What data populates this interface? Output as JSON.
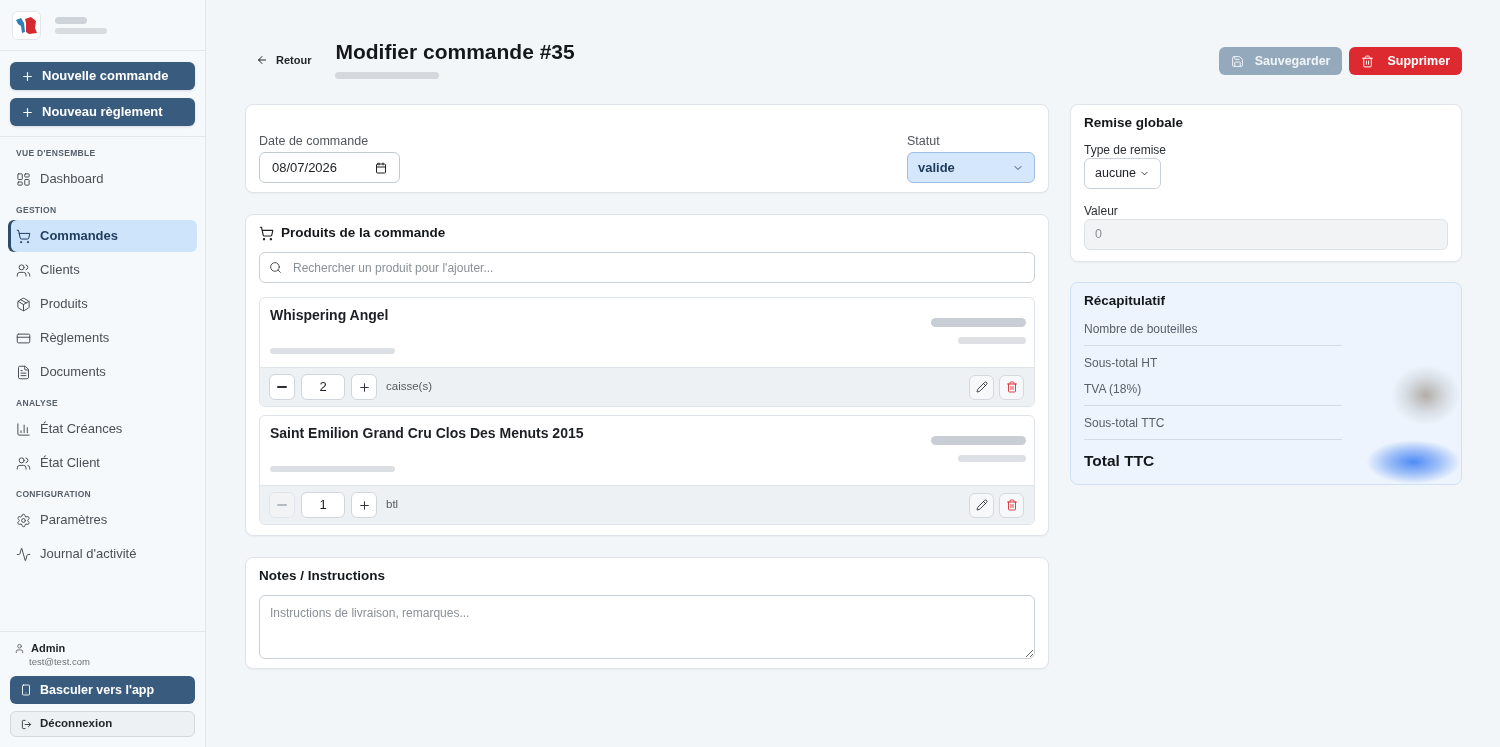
{
  "sidebar": {
    "actions": [
      {
        "label": "Nouvelle commande"
      },
      {
        "label": "Nouveau règlement"
      }
    ],
    "sections": [
      {
        "title": "VUE D'ENSEMBLE",
        "items": [
          {
            "label": "Dashboard",
            "selected": false
          }
        ]
      },
      {
        "title": "GESTION",
        "items": [
          {
            "label": "Commandes",
            "selected": true
          },
          {
            "label": "Clients",
            "selected": false
          },
          {
            "label": "Produits",
            "selected": false
          },
          {
            "label": "Règlements",
            "selected": false
          },
          {
            "label": "Documents",
            "selected": false
          }
        ]
      },
      {
        "title": "ANALYSE",
        "items": [
          {
            "label": "État Créances",
            "selected": false
          },
          {
            "label": "État Client",
            "selected": false
          }
        ]
      },
      {
        "title": "CONFIGURATION",
        "items": [
          {
            "label": "Paramètres",
            "selected": false
          },
          {
            "label": "Journal d'activité",
            "selected": false
          }
        ]
      }
    ],
    "user": {
      "name": "Admin",
      "email": "test@test.com"
    },
    "footer_buttons": [
      {
        "label": "Basculer vers l'app",
        "kind": "primary"
      },
      {
        "label": "Déconnexion",
        "kind": "secondary"
      }
    ]
  },
  "header": {
    "back": "Retour",
    "title": "Modifier commande #35",
    "buttons": [
      {
        "label": "Sauvegarder",
        "kind": "save",
        "disabled": true
      },
      {
        "label": "Supprimer",
        "kind": "delete",
        "disabled": false
      }
    ]
  },
  "order": {
    "date_label": "Date de commande",
    "date_value": "08/07/2026",
    "status_label": "Statut",
    "status_value": "valide"
  },
  "products": {
    "title": "Produits de la commande",
    "search": {
      "placeholder": "Rechercher un produit pour l'ajouter..."
    },
    "items": [
      {
        "name": "Whispering Angel",
        "quantity": "2",
        "unit": "caisse(s)",
        "minus_disabled": false
      },
      {
        "name": "Saint Emilion Grand Cru Clos Des Menuts 2015",
        "quantity": "1",
        "unit": "btl",
        "minus_disabled": true
      }
    ]
  },
  "notes": {
    "title": "Notes / Instructions",
    "field": {
      "placeholder": "Instructions de livraison, remarques..."
    }
  },
  "discount": {
    "title": "Remise globale",
    "type_label": "Type de remise",
    "type_value": "aucune",
    "value_label": "Valeur",
    "value": "0",
    "value_disabled": true
  },
  "summary": {
    "title": "Récapitulatif",
    "groups": [
      [
        "Nombre de bouteilles"
      ],
      [
        "Sous-total HT",
        "TVA (18%)"
      ],
      [
        "Sous-total TTC"
      ]
    ],
    "total": "Total TTC"
  }
}
